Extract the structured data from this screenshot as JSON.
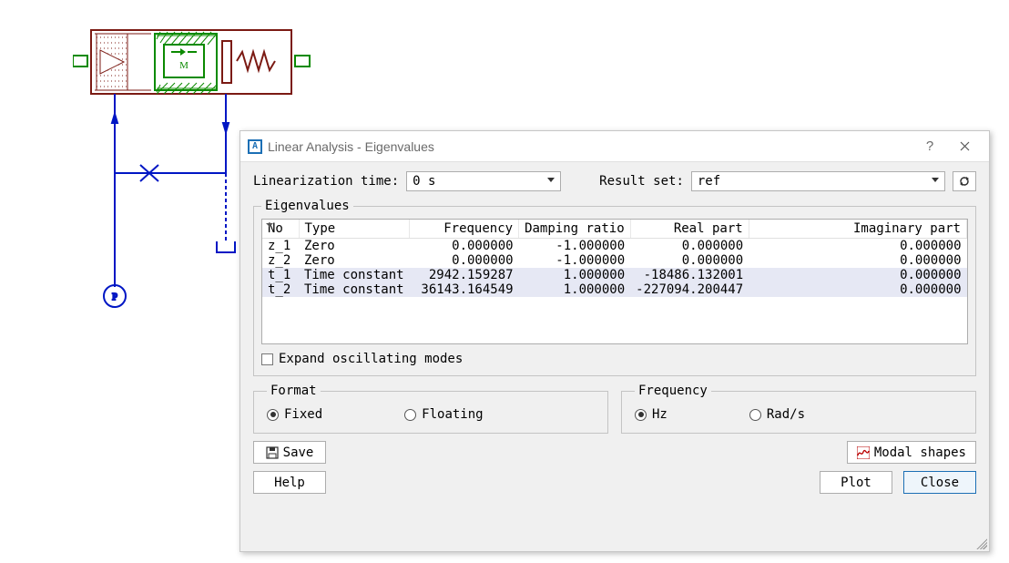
{
  "schematic": {
    "description": "hydraulic-electromechanical schematic"
  },
  "dialog": {
    "title": "Linear Analysis - Eigenvalues",
    "help_hint": "?",
    "labels": {
      "linearization_time": "Linearization time:",
      "result_set": "Result set:",
      "eigenvalues": "Eigenvalues",
      "expand_modes": "Expand oscillating modes",
      "format": "Format",
      "frequency": "Frequency",
      "fixed": "Fixed",
      "floating": "Floating",
      "hz": "Hz",
      "rads": "Rad/s",
      "save": "Save",
      "modal_shapes": "Modal shapes",
      "help": "Help",
      "plot": "Plot",
      "close": "Close"
    },
    "linearization_time_value": "0 s",
    "result_set_value": "ref",
    "table": {
      "columns": [
        "No",
        "Type",
        "Frequency",
        "Damping ratio",
        "Real part",
        "Imaginary part"
      ],
      "rows": [
        {
          "no": "z_1",
          "type": "Zero",
          "freq": "0.000000",
          "damp": "-1.000000",
          "real": "0.000000",
          "imag": "0.000000",
          "highlight": false
        },
        {
          "no": "z_2",
          "type": "Zero",
          "freq": "0.000000",
          "damp": "-1.000000",
          "real": "0.000000",
          "imag": "0.000000",
          "highlight": false
        },
        {
          "no": "t_1",
          "type": "Time constant",
          "freq": "2942.159287",
          "damp": "1.000000",
          "real": "-18486.132001",
          "imag": "0.000000",
          "highlight": true
        },
        {
          "no": "t_2",
          "type": "Time constant",
          "freq": "36143.164549",
          "damp": "1.000000",
          "real": "-227094.200447",
          "imag": "0.000000",
          "highlight": true
        }
      ]
    },
    "expand_checked": false,
    "format_selected": "fixed",
    "frequency_selected": "hz"
  }
}
